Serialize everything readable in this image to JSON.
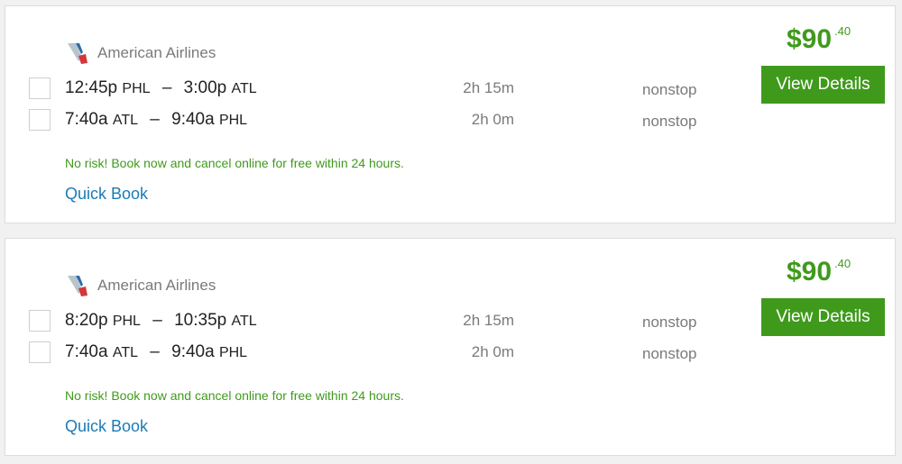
{
  "results": [
    {
      "airline": "American Airlines",
      "price_dollars": "$90",
      "price_cents": ".40",
      "view_details_label": "View Details",
      "risk_text": "No risk! Book now and cancel online for free within 24 hours.",
      "quick_book_label": "Quick Book",
      "legs": [
        {
          "depart_time": "12:45p",
          "depart_code": "PHL",
          "arrive_time": "3:00p",
          "arrive_code": "ATL",
          "duration": "2h 15m",
          "stops": "nonstop"
        },
        {
          "depart_time": "7:40a",
          "depart_code": "ATL",
          "arrive_time": "9:40a",
          "arrive_code": "PHL",
          "duration": "2h 0m",
          "stops": "nonstop"
        }
      ]
    },
    {
      "airline": "American Airlines",
      "price_dollars": "$90",
      "price_cents": ".40",
      "view_details_label": "View Details",
      "risk_text": "No risk! Book now and cancel online for free within 24 hours.",
      "quick_book_label": "Quick Book",
      "legs": [
        {
          "depart_time": "8:20p",
          "depart_code": "PHL",
          "arrive_time": "10:35p",
          "arrive_code": "ATL",
          "duration": "2h 15m",
          "stops": "nonstop"
        },
        {
          "depart_time": "7:40a",
          "depart_code": "ATL",
          "arrive_time": "9:40a",
          "arrive_code": "PHL",
          "duration": "2h 0m",
          "stops": "nonstop"
        }
      ]
    }
  ],
  "icons": {
    "airline_logo": "american-airlines-logo-icon"
  },
  "colors": {
    "accent_green": "#3f9a1c",
    "link_blue": "#1b7bb5"
  }
}
